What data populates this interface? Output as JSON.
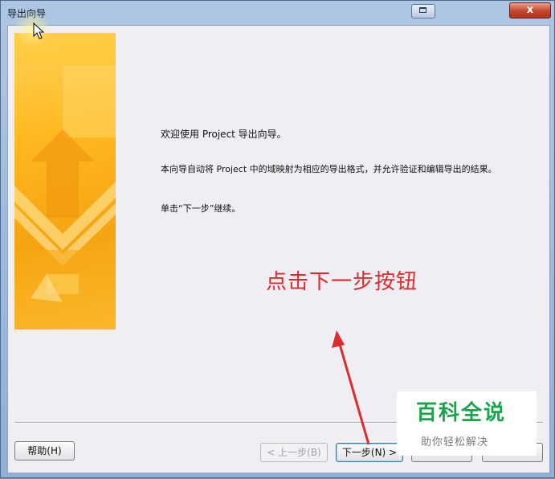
{
  "window": {
    "title": "导出向导",
    "close_label": "x"
  },
  "content": {
    "welcome": "欢迎使用 Project 导出向导。",
    "description": "本向导自动将 Project 中的域映射为相应的导出格式，并允许验证和编辑导出的结果。",
    "instruction": "单击“下一步”继续。"
  },
  "annotation": {
    "text": "点击下一步按钮",
    "color": "#de2b2b"
  },
  "buttons": {
    "help": "帮助(H)",
    "prev": "< 上一步(B)",
    "next": "下一步(N) >",
    "finish": "",
    "cancel": ""
  },
  "watermark": {
    "title": "百科全说",
    "subtitle": "助你轻松解决",
    "color": "#1aa54a"
  },
  "colors": {
    "banner_primary": "#ffb81f",
    "close_button": "#c4432c"
  }
}
